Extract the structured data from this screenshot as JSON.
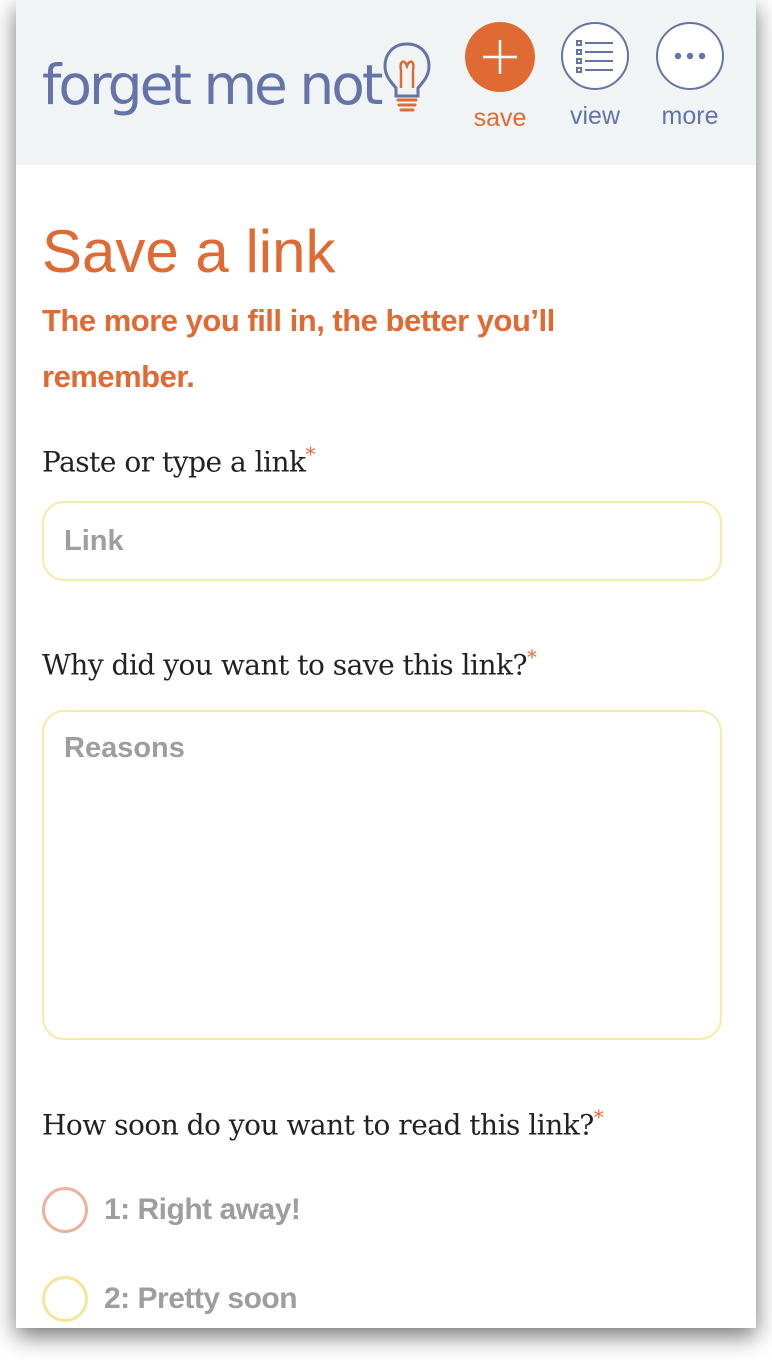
{
  "header": {
    "logo_text": "forget me not",
    "nav": [
      {
        "label": "save",
        "icon": "plus-icon"
      },
      {
        "label": "view",
        "icon": "list-icon"
      },
      {
        "label": "more",
        "icon": "ellipsis-icon"
      }
    ]
  },
  "form": {
    "title": "Save a link",
    "subtitle": "The more you fill in, the better you’ll remember.",
    "required_mark": "*",
    "link": {
      "label": "Paste or type a link",
      "placeholder": "Link",
      "value": ""
    },
    "reasons": {
      "label": "Why did you want to save this link?",
      "placeholder": "Reasons",
      "value": ""
    },
    "priority": {
      "label": "How soon do you want to read this link?",
      "options": [
        {
          "label": "1: Right away!",
          "color": "#eab39e"
        },
        {
          "label": "2: Pretty soon",
          "color": "#f5e59c"
        }
      ]
    }
  },
  "colors": {
    "accent": "#e06a34",
    "brand": "#6573a8",
    "header_bg": "#f0f4f5",
    "input_border": "#f7eaa8"
  }
}
